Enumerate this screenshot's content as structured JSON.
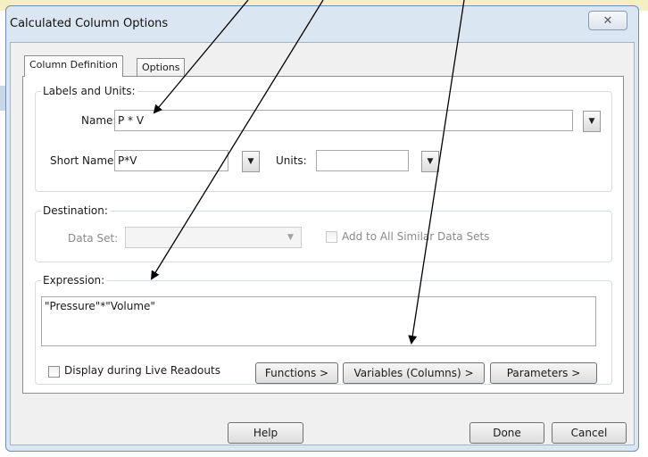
{
  "window": {
    "title": "Calculated Column Options",
    "close_glyph": "✕"
  },
  "tabs": [
    {
      "label": "Column Definition",
      "active": true
    },
    {
      "label": "Options",
      "active": false
    }
  ],
  "labels_units": {
    "group_label": "Labels and Units:",
    "name_label": "Name:",
    "name_value": "P * V",
    "short_name_label": "Short Name:",
    "short_name_value": "P*V",
    "units_label": "Units:",
    "units_value": ""
  },
  "destination": {
    "group_label": "Destination:",
    "data_set_label": "Data Set:",
    "data_set_value": "",
    "add_all_label": "Add to All Similar Data Sets",
    "add_all_checked": false
  },
  "expression": {
    "group_label": "Expression:",
    "value": "\"Pressure\"*\"Volume\"",
    "live_readouts_label": "Display during Live Readouts",
    "live_readouts_checked": false,
    "functions_button": "Functions >",
    "variables_button": "Variables (Columns) >",
    "parameters_button": "Parameters >"
  },
  "footer": {
    "help_button": "Help",
    "done_button": "Done",
    "cancel_button": "Cancel"
  },
  "icons": {
    "dropdown": "dropdown-arrow-icon",
    "close": "close-icon"
  },
  "colors": {
    "annotation_arrow": "#000000",
    "window_frame": "#dbe6f3",
    "panel": "#ffffff"
  }
}
